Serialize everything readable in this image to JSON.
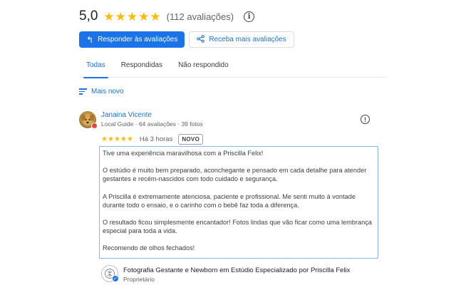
{
  "summary": {
    "score": "5,0",
    "stars": 5,
    "count_text": "(112 avaliações)",
    "info_icon": "info-icon"
  },
  "actions": {
    "reply_label": "Responder às avaliações",
    "reply_icon": "reply-icon",
    "get_more_label": "Receba mais avaliações",
    "get_more_icon": "share-icon"
  },
  "tabs": [
    {
      "label": "Todas",
      "active": true
    },
    {
      "label": "Respondidas",
      "active": false
    },
    {
      "label": "Não respondido",
      "active": false
    }
  ],
  "sort": {
    "label": "Mais novo",
    "icon": "sort-icon"
  },
  "review": {
    "reviewer_name": "Janaina Vicente",
    "reviewer_meta": "Local Guide · 64 avaliações · 39 fotos",
    "stars": 5,
    "time": "Há 3 horas",
    "badge": "NOVO",
    "paragraphs": [
      "Tive uma experiência maravilhosa com a Priscilla Felix!",
      "O estúdio é muito bem preparado, aconchegante e pensado em cada detalhe para atender gestantes e recém-nascidos com todo cuidado e segurança.",
      "A Priscilla é extremamente atenciosa, paciente e profissional. Me senti muito à vontade durante todo o ensaio, e o carinho com o bebê faz toda a diferença.",
      "O resultado ficou simplesmente encantador! Fotos lindas que vão ficar como uma lembrança especial para toda a vida.",
      "Recomendo de olhos fechados!"
    ]
  },
  "owner": {
    "name": "Fotografia Gestante e Newborn em Estúdio Especializado por Priscilla Felix",
    "role": "Proprietário"
  },
  "colors": {
    "accent": "#1a73e8",
    "star": "#fbbc04",
    "text": "#202124",
    "muted": "#5f6368"
  }
}
